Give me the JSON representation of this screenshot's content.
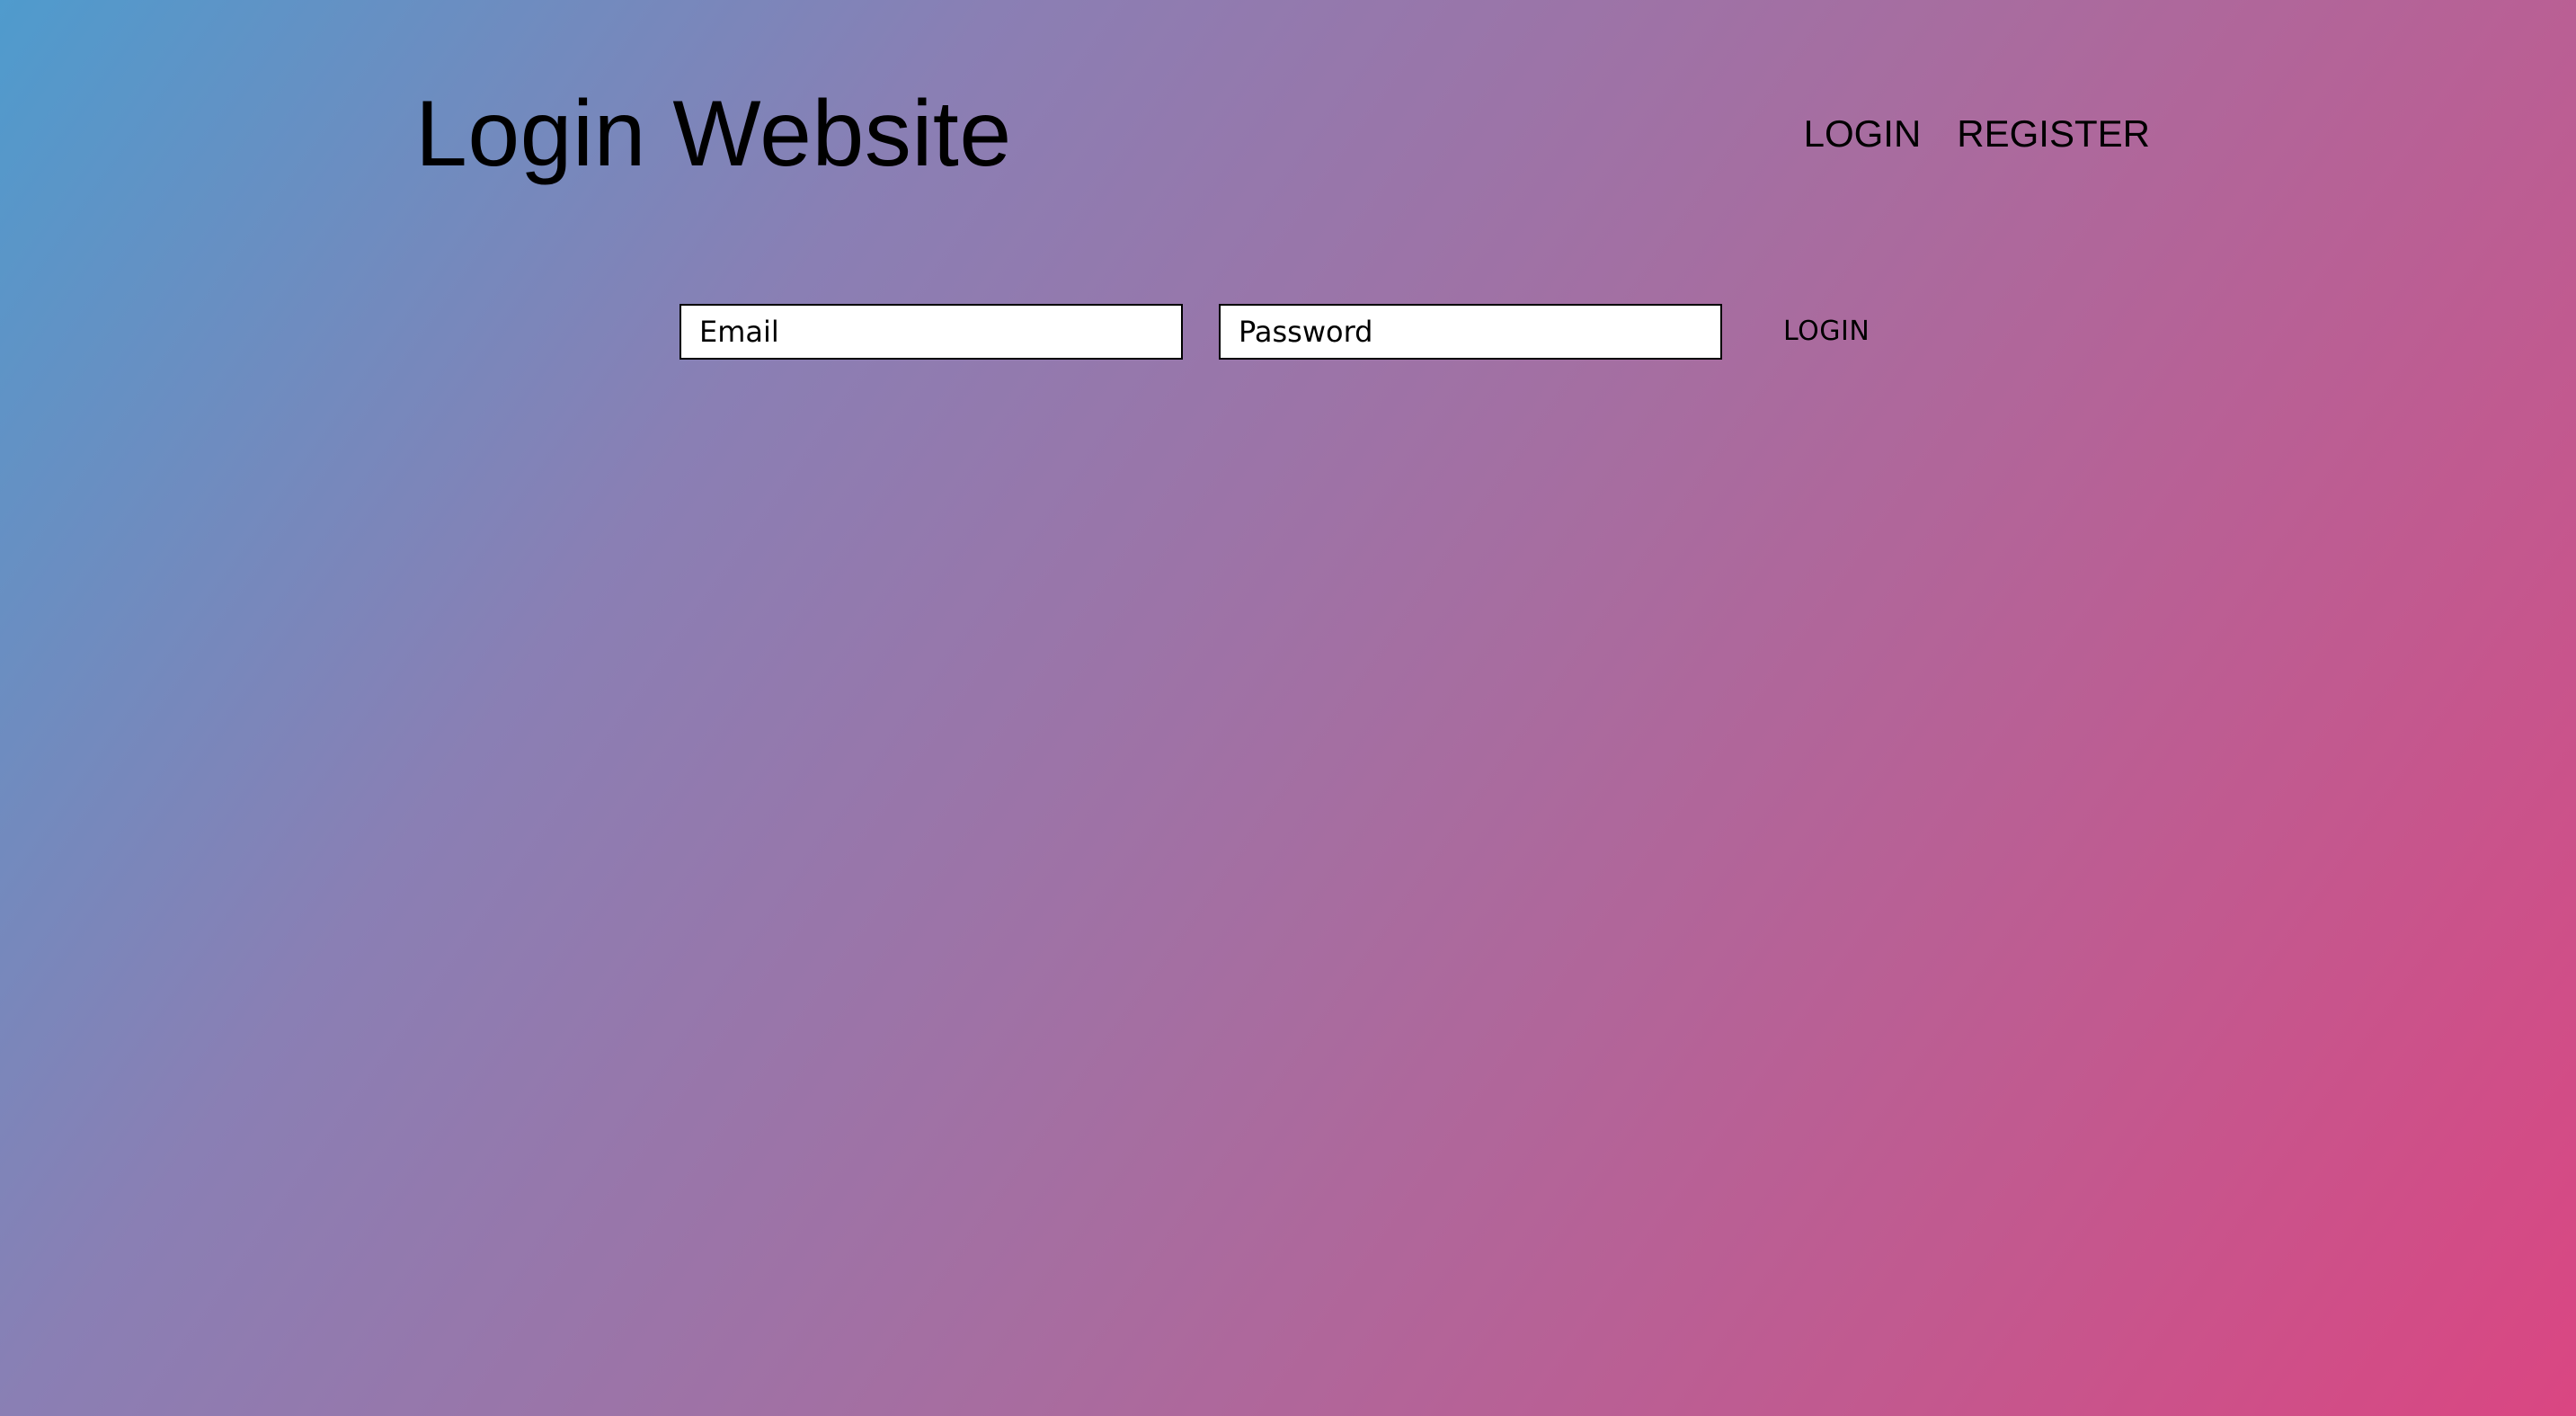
{
  "header": {
    "title": "Login Website",
    "nav": {
      "login_label": "LOGIN",
      "register_label": "REGISTER"
    }
  },
  "login_form": {
    "email": {
      "placeholder": "Email",
      "value": ""
    },
    "password": {
      "placeholder": "Password",
      "value": ""
    },
    "submit_label": "LOGIN"
  },
  "colors": {
    "gradient_start": "#4f9bcd",
    "gradient_end": "#da4682",
    "text": "#000000",
    "input_background": "#ffffff"
  }
}
